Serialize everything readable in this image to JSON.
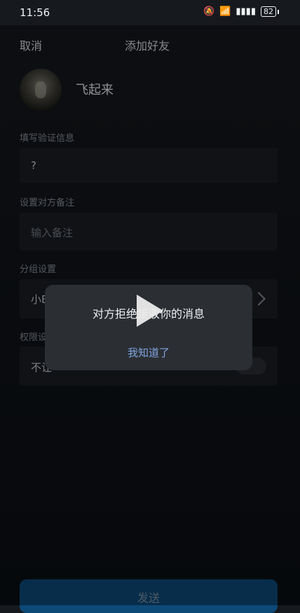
{
  "status_bar": {
    "time": "11:56",
    "battery": "82",
    "icons": [
      "mute-icon",
      "wifi-icon",
      "signal-icon",
      "battery-icon"
    ]
  },
  "header": {
    "cancel_label": "取消",
    "title": "添加好友"
  },
  "profile": {
    "nickname": "飞起来"
  },
  "form": {
    "verify_label": "填写验证信息",
    "verify_value": "?",
    "remark_label": "设置对方备注",
    "remark_placeholder": "输入备注",
    "group_label": "分组设置",
    "group_value": "小E",
    "permission_label": "权限设",
    "permission_value": "不让"
  },
  "dialog": {
    "message": "对方拒绝接收你的消息",
    "confirm_label": "我知道了"
  },
  "send_label": "发送",
  "colors": {
    "dialog_bg": "#2b2e33",
    "dialog_button": "#7fa5e0",
    "send_bg": "#0e4a78"
  }
}
